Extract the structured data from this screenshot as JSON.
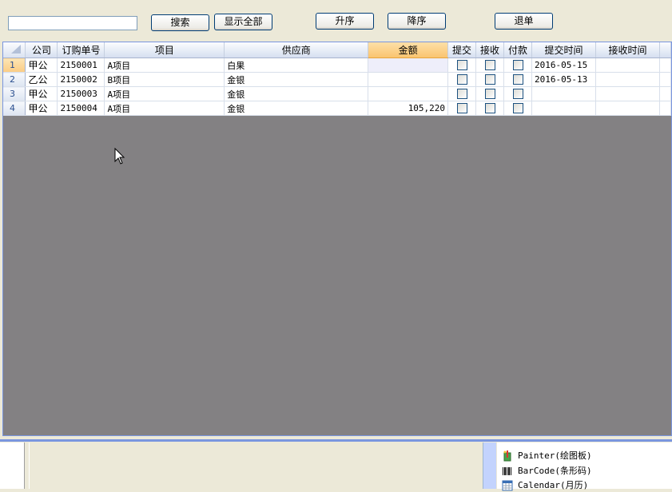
{
  "toolbar": {
    "search_value": "",
    "search_label": "搜索",
    "show_all_label": "显示全部",
    "asc_label": "升序",
    "desc_label": "降序",
    "exit_label": "退单"
  },
  "grid": {
    "columns": {
      "company": "公司",
      "order_no": "订购单号",
      "item": "项目",
      "supplier": "供应商",
      "amount": "金额",
      "submit": "提交",
      "receive": "接收",
      "pay": "付款",
      "submit_time": "提交时间",
      "receive_time": "接收时间"
    },
    "rows": [
      {
        "num": "1",
        "company": "甲公",
        "order_no": "2150001",
        "item": "A项目",
        "supplier": "白果",
        "amount": "",
        "submit_time": "2016-05-15",
        "receive_time": ""
      },
      {
        "num": "2",
        "company": "乙公",
        "order_no": "2150002",
        "item": "B项目",
        "supplier": "金银",
        "amount": "",
        "submit_time": "2016-05-13",
        "receive_time": ""
      },
      {
        "num": "3",
        "company": "甲公",
        "order_no": "2150003",
        "item": "A项目",
        "supplier": "金银",
        "amount": "",
        "submit_time": "",
        "receive_time": ""
      },
      {
        "num": "4",
        "company": "甲公",
        "order_no": "2150004",
        "item": "A项目",
        "supplier": "金银",
        "amount": "105,220",
        "submit_time": "",
        "receive_time": ""
      }
    ]
  },
  "toolbox": {
    "items": [
      {
        "label": "Painter(绘图板)",
        "icon": "painter-icon"
      },
      {
        "label": "BarCode(条形码)",
        "icon": "barcode-icon"
      },
      {
        "label": "Calendar(月历)",
        "icon": "calendar-icon"
      }
    ]
  },
  "colors": {
    "sorted_header": "#fac46f",
    "grid_empty": "#838183",
    "selection_border": "#7a96df"
  }
}
